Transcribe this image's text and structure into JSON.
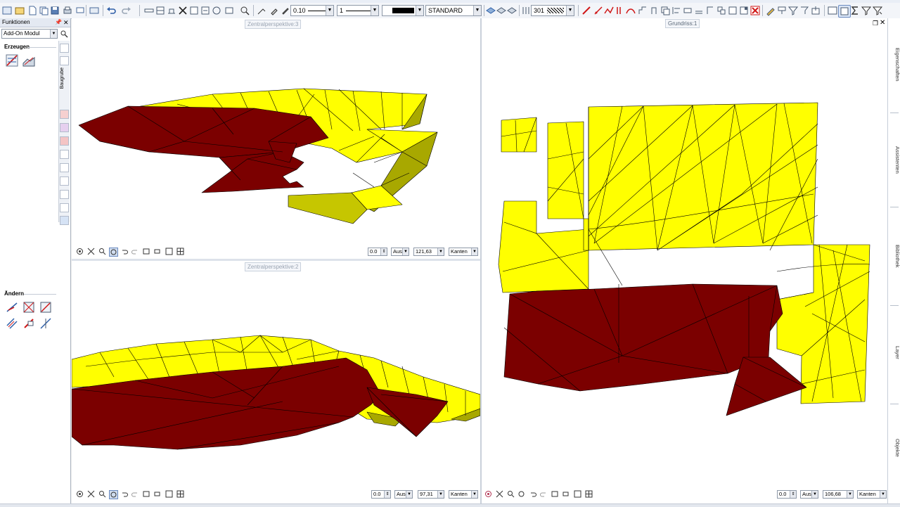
{
  "toolbar": {
    "pen_thickness": "0.10",
    "line_type": "1",
    "color_number": "1",
    "layer": "STANDARD",
    "pattern_value": "301"
  },
  "palette": {
    "title": "Funktionen",
    "module_select": "Add-On Modul",
    "section_create": "Erzeugen",
    "section_modify": "Ändern",
    "side_tab": "Baugrube"
  },
  "viewports": {
    "top_left": {
      "title": "Zentralperspektive:3",
      "angle": "0.0",
      "mode": "Aus",
      "scale": "121,63",
      "display": "Kanten"
    },
    "bottom_left": {
      "title": "Zentralperspektive:2",
      "angle": "0.0",
      "mode": "Aus",
      "scale": "97,31",
      "display": "Kanten"
    },
    "right": {
      "title": "Grundriss:1",
      "angle": "0.0",
      "mode": "Aus",
      "scale": "106,68",
      "display": "Kanten"
    }
  },
  "right_tabs": [
    "Eigenschaften",
    "Assistenten",
    "Bibliothek",
    "Layer",
    "Objekte"
  ],
  "colors": {
    "terrain_yellow": "#ffff00",
    "excavation_red": "#7b0000",
    "side_olive": "#a8a800",
    "edge": "#000000"
  }
}
